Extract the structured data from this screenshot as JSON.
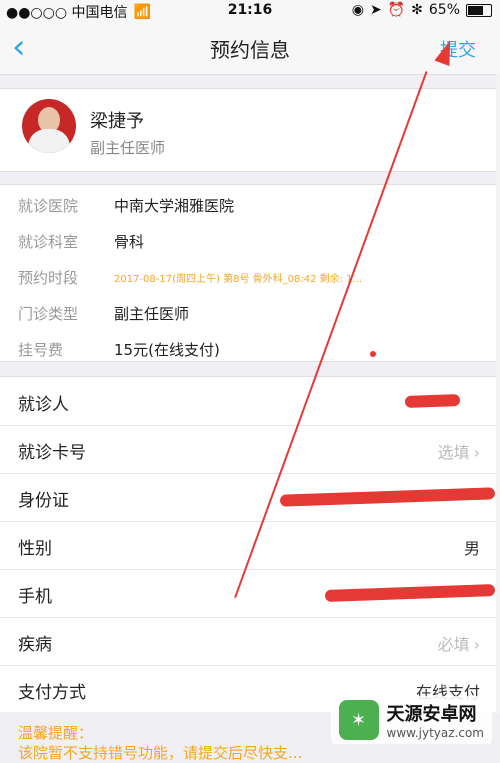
{
  "status_bar": {
    "carrier": "●●○○○ 中国电信",
    "time": "21:16",
    "battery": "65%"
  },
  "nav": {
    "title": "预约信息",
    "submit": "提交"
  },
  "doctor": {
    "name": "梁捷予",
    "title": "副主任医师"
  },
  "info": {
    "hospital_label": "就诊医院",
    "hospital_value": "中南大学湘雅医院",
    "department_label": "就诊科室",
    "department_value": "骨科",
    "time_label": "预约时段",
    "time_value": "2017-08-17(周四上午) 第8号 骨外科_08:42 剩余: 1...",
    "type_label": "门诊类型",
    "type_value": "副主任医师",
    "fee_label": "挂号费",
    "fee_value": "15元(在线支付)"
  },
  "form": {
    "patient_label": "就诊人",
    "card_label": "就诊卡号",
    "card_value": "选填",
    "id_label": "身份证",
    "gender_label": "性别",
    "gender_value": "男",
    "phone_label": "手机",
    "disease_label": "疾病",
    "disease_value": "必填",
    "payment_label": "支付方式",
    "payment_value": "在线支付"
  },
  "tips": {
    "title": "温馨提醒：",
    "text": "该院暂不支持错号功能，请提交后尽快支..."
  },
  "watermark": {
    "title": "天源安卓网",
    "url": "www.jytyaz.com"
  },
  "colors": {
    "accent": "#2aa9e6",
    "warning": "#f5a623",
    "annotation": "#e53935"
  }
}
